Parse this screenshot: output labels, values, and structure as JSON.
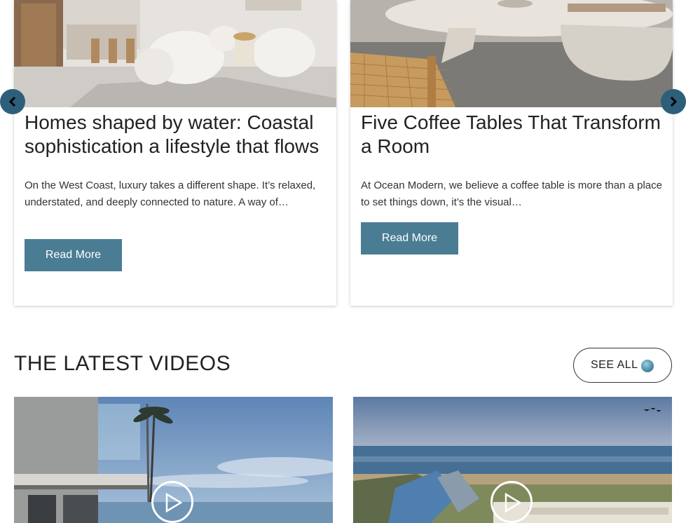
{
  "blog_cards": [
    {
      "title": "Homes shaped by water: Coastal sophistication a lifestyle that flows",
      "excerpt": "On the West Coast, luxury takes a different shape. It’s relaxed, understated, and deeply connected to nature. A way of…",
      "button_label": "Read More"
    },
    {
      "title": "Five Coffee Tables That Transform a Room",
      "excerpt": "At Ocean Modern, we believe a coffee table is more than a place to set things down, it’s the visual…",
      "button_label": "Read More"
    }
  ],
  "carousel": {
    "prev_icon": "chevron-left-icon",
    "next_icon": "chevron-right-icon"
  },
  "videos_section": {
    "title": "THE LATEST VIDEOS",
    "see_all_label": "SEE ALL"
  },
  "videos": [
    {
      "icon": "play-icon"
    },
    {
      "icon": "play-icon"
    }
  ],
  "colors": {
    "button_bg": "#4a7d94",
    "arrow_bg": "#2d5f7a"
  }
}
